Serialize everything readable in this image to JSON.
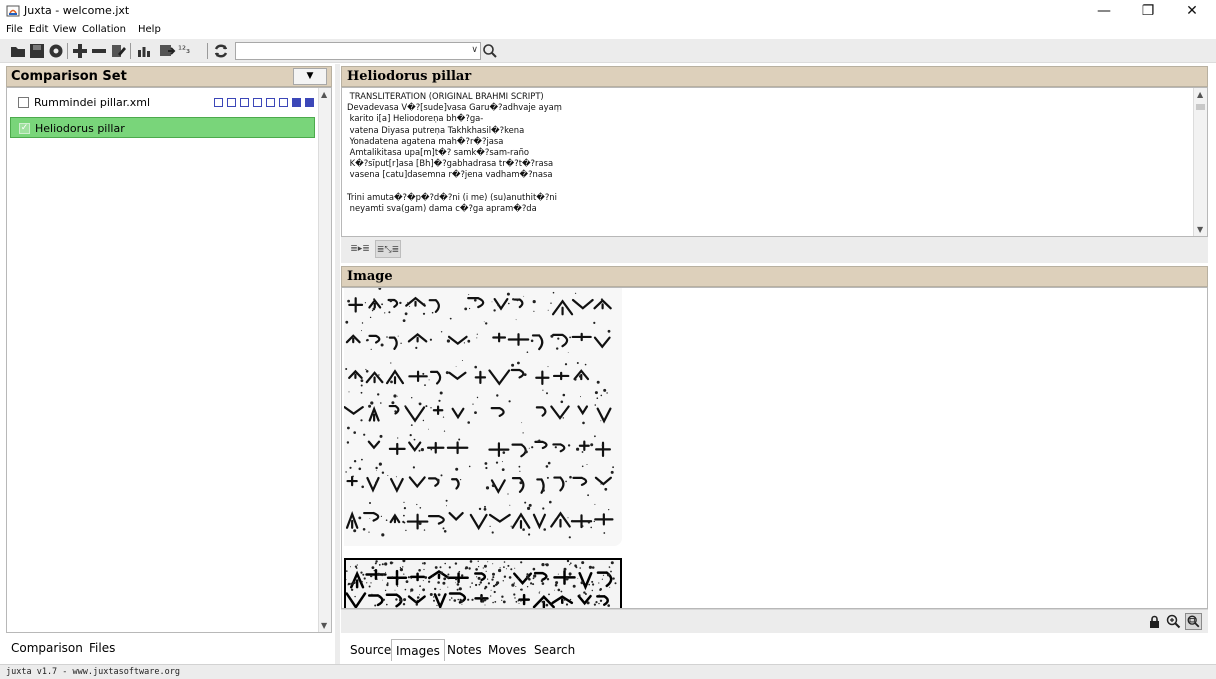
{
  "window": {
    "title": "Juxta - welcome.jxt",
    "controls": {
      "minimize": "—",
      "maximize": "❐",
      "close": "✕"
    }
  },
  "menu": [
    "File",
    "Edit",
    "View",
    "Collation",
    "Help"
  ],
  "toolbar": {
    "buttons": [
      "open-folder-icon",
      "save-icon",
      "settings-gear-icon",
      "add-icon",
      "remove-icon",
      "edit-icon",
      "chart-icon",
      "export-icon",
      "line-numbers-icon",
      "refresh-icon"
    ],
    "line_numbers_text": "¹²₃",
    "search": {
      "value": "",
      "arrow": "∨"
    }
  },
  "left_panel": {
    "title": "Comparison Set",
    "dropdown": "▼",
    "items": [
      {
        "label": "Rummindei pillar.xml",
        "checked": false,
        "selected": false,
        "squares": 8,
        "filled_from": 6
      },
      {
        "label": "Heliodorus pillar",
        "checked": true,
        "selected": true
      }
    ],
    "tabs": [
      "Comparison",
      "Files"
    ]
  },
  "source_panel": {
    "title": "Heliodorus pillar",
    "lines": [
      " TRANSLITERATION (ORIGINAL BRAHMI SCRIPT)",
      "Devadevasa V�?[sude]vasa Garu�?adhvaje ayaṃ",
      " karito i[a] Heliodoreṇa bh�?ga-",
      " vatena Diyasa putreṇa Takhkhasil�?kena",
      " Yonadatena agatena mah�?r�?jasa",
      " Amtalikitasa upa[m]t�? samk�?sam-raño",
      " K�?sīput[r]asa [Bh]�?gabhadrasa tr�?t�?rasa",
      " vasena [catu]dasemna r�?jena vadham�?nasa",
      "",
      "Trini amuta�?�p�?d�?ni (i me) (su)anuthit�?ni",
      " neyamti sva(gam) dama c�?ga apram�?da"
    ],
    "toolbar_buttons": [
      "≣▸≣",
      "≣⤡≣"
    ]
  },
  "image_panel": {
    "title": "Image",
    "images": [
      "inscription-image-1",
      "inscription-image-2"
    ],
    "tools": [
      "lock-icon",
      "zoom-in-icon",
      "zoom-fit-icon"
    ]
  },
  "bottom_tabs": {
    "items": [
      "Source",
      "Images",
      "Notes",
      "Moves",
      "Search"
    ],
    "active": "Images"
  },
  "status": "juxta v1.7 - www.juxtasoftware.org",
  "colors": {
    "panel_header": "#ddd0bb",
    "selected_row": "#79d57a",
    "square_outline": "#3c47b8",
    "square_fill": "#3c47b8"
  }
}
